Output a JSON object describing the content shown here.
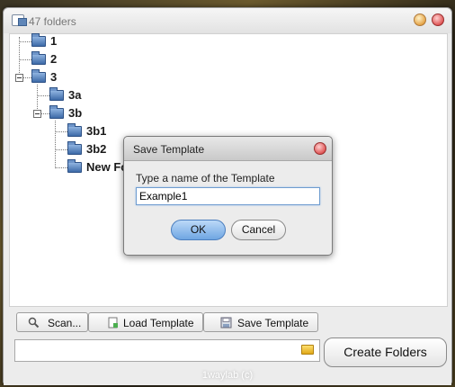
{
  "window": {
    "title": "47 folders"
  },
  "tree": {
    "nodes": [
      {
        "label": "1"
      },
      {
        "label": "2"
      },
      {
        "label": "3"
      },
      {
        "label": "3a"
      },
      {
        "label": "3b"
      },
      {
        "label": "3b1"
      },
      {
        "label": "3b2"
      },
      {
        "label": "New Fo"
      }
    ]
  },
  "toolbar": {
    "scan_label": "Scan...",
    "load_template_label": "Load Template",
    "save_template_label": "Save Template"
  },
  "path_input": {
    "value": ""
  },
  "create_folders_label": "Create Folders",
  "footer": "1waylab (c)",
  "dialog": {
    "title": "Save Template",
    "prompt": "Type a name of the Template",
    "input_value": "Example1",
    "ok_label": "OK",
    "cancel_label": "Cancel"
  }
}
